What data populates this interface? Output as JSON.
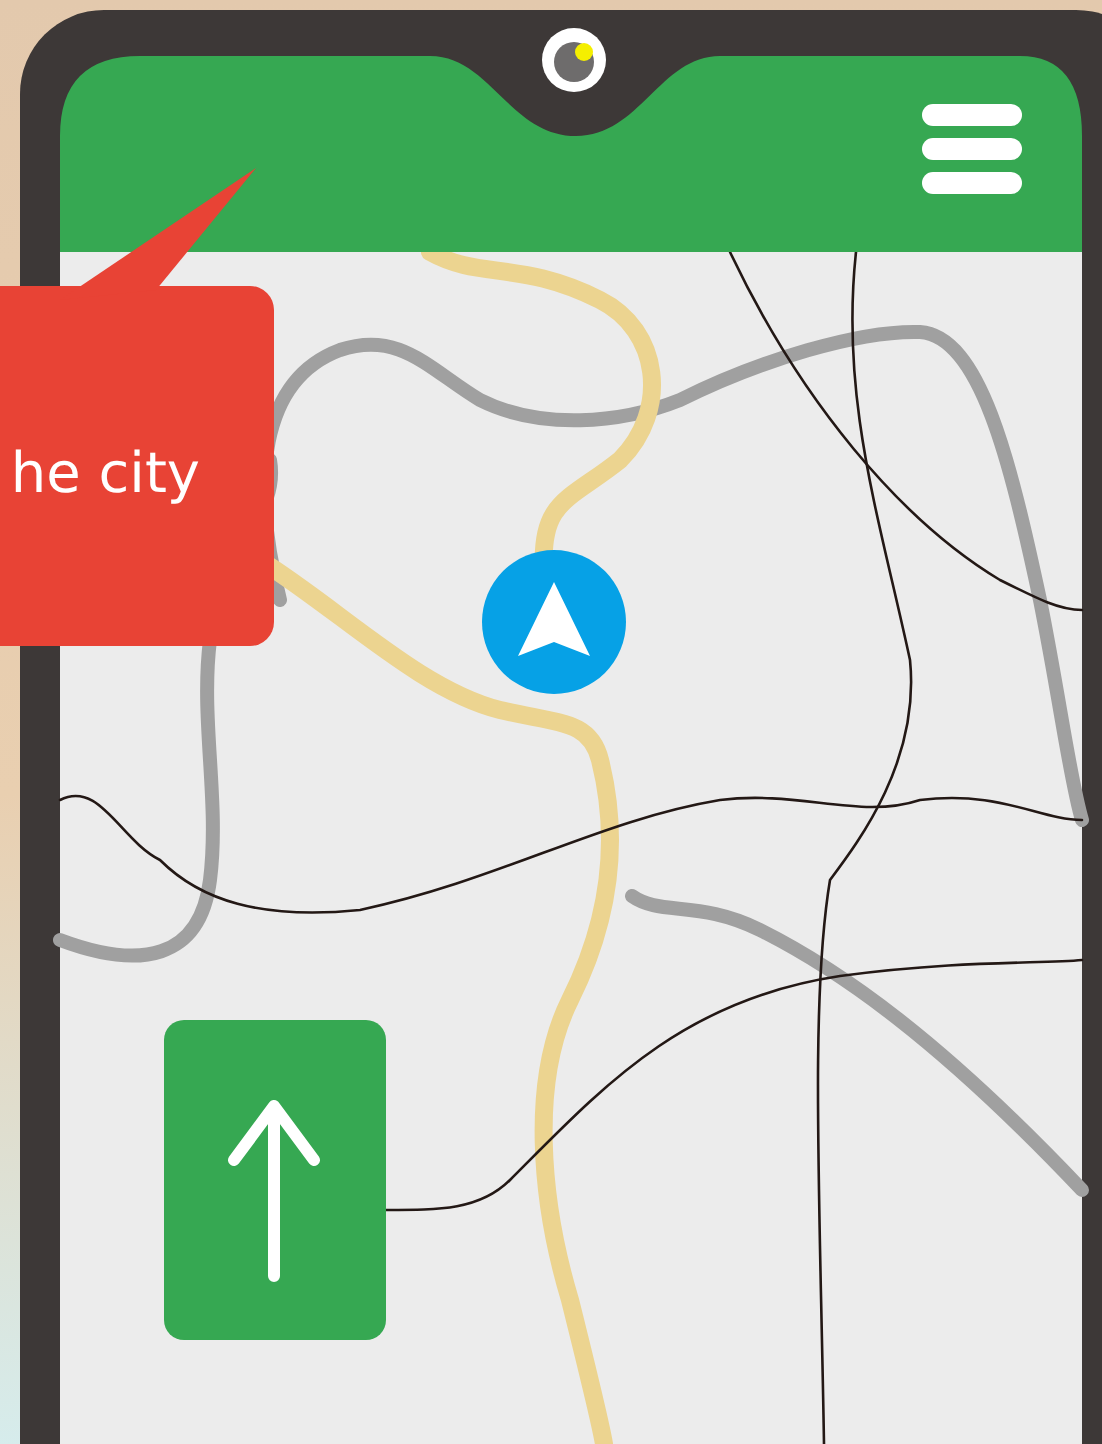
{
  "callout": {
    "text": "he city"
  }
}
